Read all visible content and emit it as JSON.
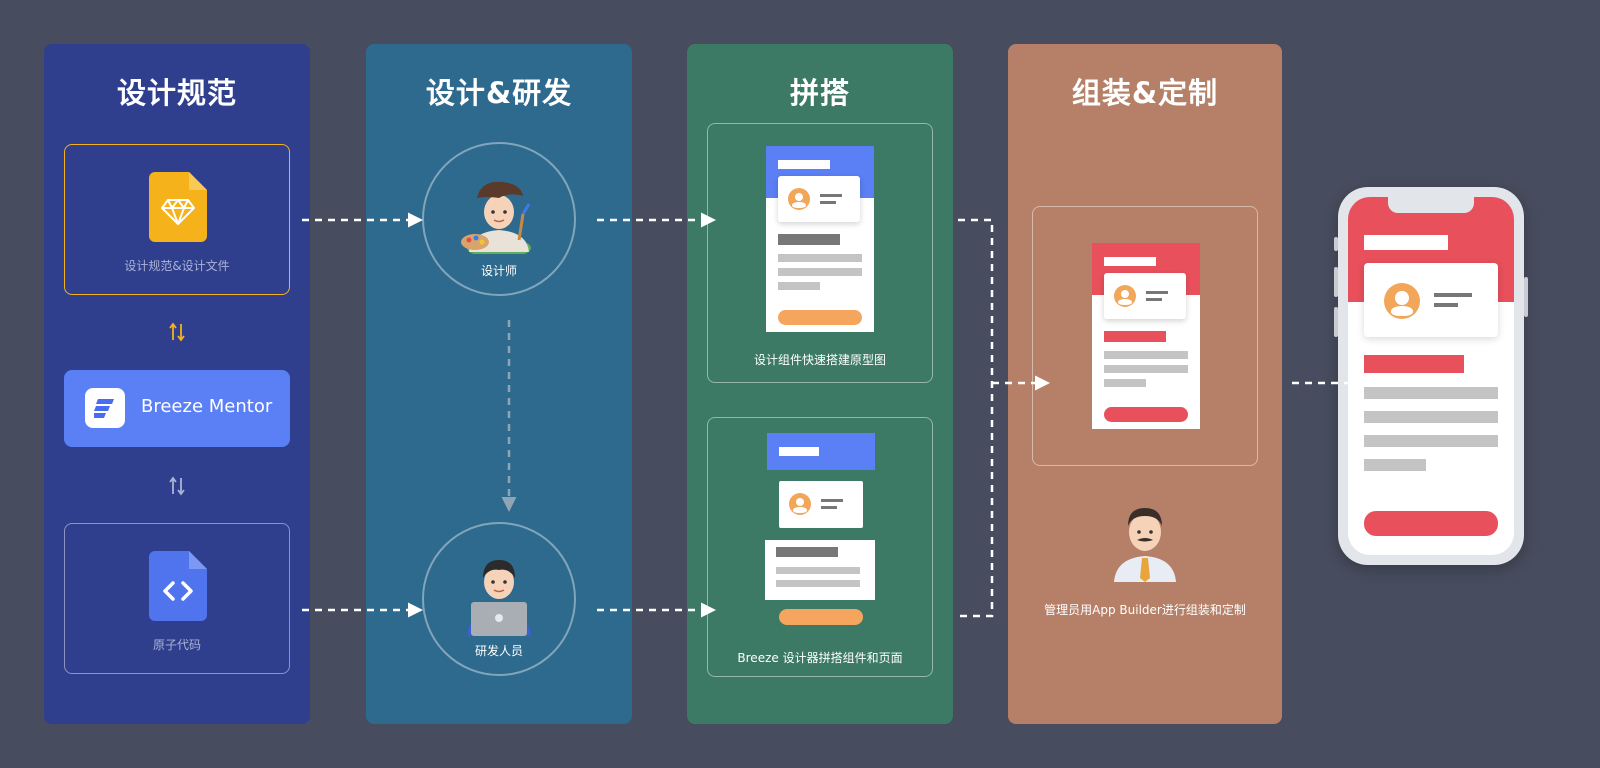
{
  "columns": {
    "spec": {
      "title": "设计规范",
      "color": "#2f3f8e"
    },
    "design_dev": {
      "title": "设计&研发",
      "color": "#2d6a8e"
    },
    "assemble": {
      "title": "拼搭",
      "color": "#3c7a66"
    },
    "custom": {
      "title": "组装&定制",
      "color": "#b58067"
    }
  },
  "spec": {
    "design_file_label": "设计规范&设计文件",
    "mentor_label": "Breeze Mentor",
    "atomic_code_label": "原子代码"
  },
  "roles": {
    "designer_label": "设计师",
    "developer_label": "研发人员",
    "admin_label": "管理员用App Builder进行组装和定制"
  },
  "assemble": {
    "prototype_label": "设计组件快速搭建原型图",
    "page_label": "Breeze 设计器拼搭组件和页面"
  },
  "icons": {
    "sketch": "sketch-icon",
    "code": "code-file-icon",
    "breeze": "breeze-logo-icon",
    "sync": "sync-arrows-icon",
    "designer": "artist-emoji-icon",
    "developer": "technologist-emoji-icon",
    "admin": "office-worker-emoji-icon",
    "phone": "mobile-phone-icon"
  },
  "colors": {
    "background": "#474c5e",
    "accent_yellow": "#f5b21b",
    "accent_blue": "#5b7ff5",
    "accent_red": "#e8505b",
    "accent_orange": "#f5a55d"
  }
}
